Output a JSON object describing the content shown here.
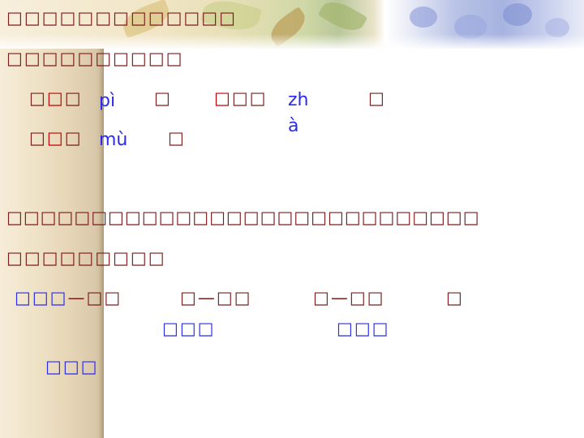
{
  "header": {
    "line1": "□□□□□□□□□□□□□",
    "line2": "□□□□□□□□□□"
  },
  "characters": {
    "item1": {
      "pre": "□",
      "mid": "□",
      "post": "□",
      "pinyin": "pì",
      "close": "□"
    },
    "item2": {
      "pre": "□",
      "rest": "□□",
      "pinyin_line1": "zh",
      "pinyin_line2": "à",
      "close": "□"
    },
    "item3": {
      "pre": "□",
      "mid": "□",
      "post": "□",
      "pinyin": "mù",
      "close": "□"
    }
  },
  "paragraph": {
    "line1": "□□□□□□□□□□□□□□□□□□□□□□□□□□□□",
    "line2": "□□□□□□□□□"
  },
  "words": {
    "group1": {
      "lead": "□□□",
      "dash": "—",
      "tail": "□□"
    },
    "group2": {
      "lead": "□",
      "dash": "—",
      "tail": "□□",
      "below": "□□□"
    },
    "group3": {
      "lead": "□",
      "dash": "—",
      "tail": "□□",
      "below": "□□□"
    },
    "end": "□",
    "bottom": "□□□"
  },
  "colors": {
    "dark_red": "#7a1c1c",
    "red": "#c00000",
    "blue": "#2a2aee"
  }
}
